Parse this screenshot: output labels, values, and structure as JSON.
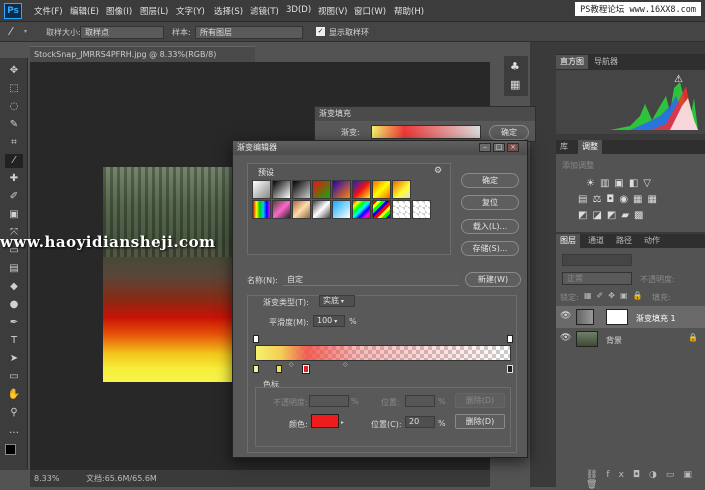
{
  "app": {
    "logo": "Ps"
  },
  "menubar": {
    "items": [
      "文件(F)",
      "编辑(E)",
      "图像(I)",
      "图层(L)",
      "文字(Y)",
      "选择(S)",
      "滤镜(T)",
      "3D(D)",
      "视图(V)",
      "窗口(W)",
      "帮助(H)"
    ],
    "watermark": "PS教程论坛 www.16XX8.com"
  },
  "optionsbar": {
    "sample_size_label": "取样大小:",
    "sample_size_value": "取样点",
    "sample_label": "样本:",
    "sample_value": "所有图层",
    "show_ring_label": "显示取样环",
    "show_ring_checked": true
  },
  "document": {
    "tab_title": "StockSnap_JMRRS4PFRH.jpg @ 8.33%(RGB/8)",
    "zoom": "8.33%",
    "doc_info": "文档:65.6M/65.6M"
  },
  "watermark_mid": "www.haoyidiansheji.com",
  "panels": {
    "top_tabs": [
      "直方图",
      "导航器"
    ],
    "mid_tabs": [
      "库",
      "调整"
    ],
    "adjust_add_label": "添加调整",
    "layer_tabs": [
      "图层",
      "通道",
      "路径",
      "动作"
    ],
    "blend_mode": "正常",
    "opacity_label": "不透明度:",
    "lock_label": "锁定:",
    "fill_label": "填充:",
    "layers": [
      {
        "name": "渐变填充 1",
        "visible": true
      },
      {
        "name": "背景",
        "visible": true,
        "locked": true
      }
    ]
  },
  "gradient_fill_dialog": {
    "title": "渐变填充",
    "gradient_label": "渐变:",
    "ok_label": "确定"
  },
  "gradient_editor": {
    "title": "渐变编辑器",
    "presets_label": "预设",
    "buttons": {
      "ok": "确定",
      "reset": "复位",
      "load": "载入(L)...",
      "save": "存储(S)...",
      "new": "新建(W)"
    },
    "name_label": "名称(N):",
    "name_value": "自定",
    "type_label": "渐变类型(T):",
    "type_value": "实底",
    "smoothness_label": "平滑度(M):",
    "smoothness_value": "100",
    "smoothness_unit": "%",
    "color_stops_label": "色标",
    "opacity_label": "不透明度:",
    "opacity_unit": "%",
    "location_label_disabled": "位置:",
    "location_unit_disabled": "%",
    "delete_disabled": "删除(D)",
    "color_label": "颜色:",
    "color_value": "#ee1c1c",
    "location_label": "位置(C):",
    "location_value": "20",
    "location_unit": "%",
    "delete_label": "删除(D)"
  },
  "icons": {
    "eyedropper": "eyedropper-icon",
    "eye": "eye-icon",
    "lock": "lock-icon",
    "gear": "gear-icon"
  }
}
